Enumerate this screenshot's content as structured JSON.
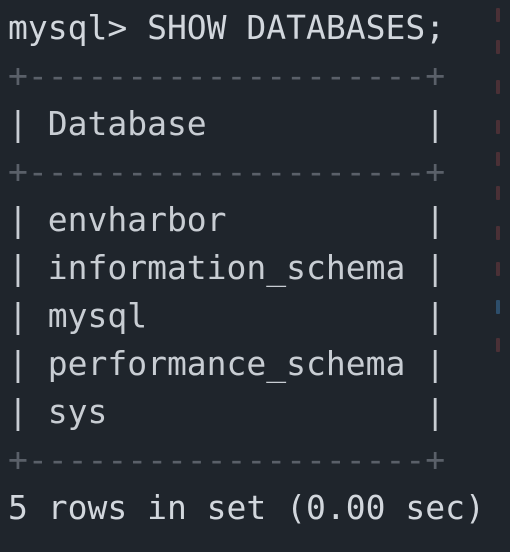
{
  "prompt": "mysql> SHOW DATABASES;",
  "table": {
    "border": "+--------------------+",
    "header_row": "| Database           |",
    "rows": [
      "| envharbor          |",
      "| information_schema |",
      "| mysql              |",
      "| performance_schema |",
      "| sys                |"
    ]
  },
  "result": "5 rows in set (0.00 sec)",
  "colors": {
    "background": "#1f252c",
    "text": "#d2d7dd",
    "border": "#5a6069"
  }
}
